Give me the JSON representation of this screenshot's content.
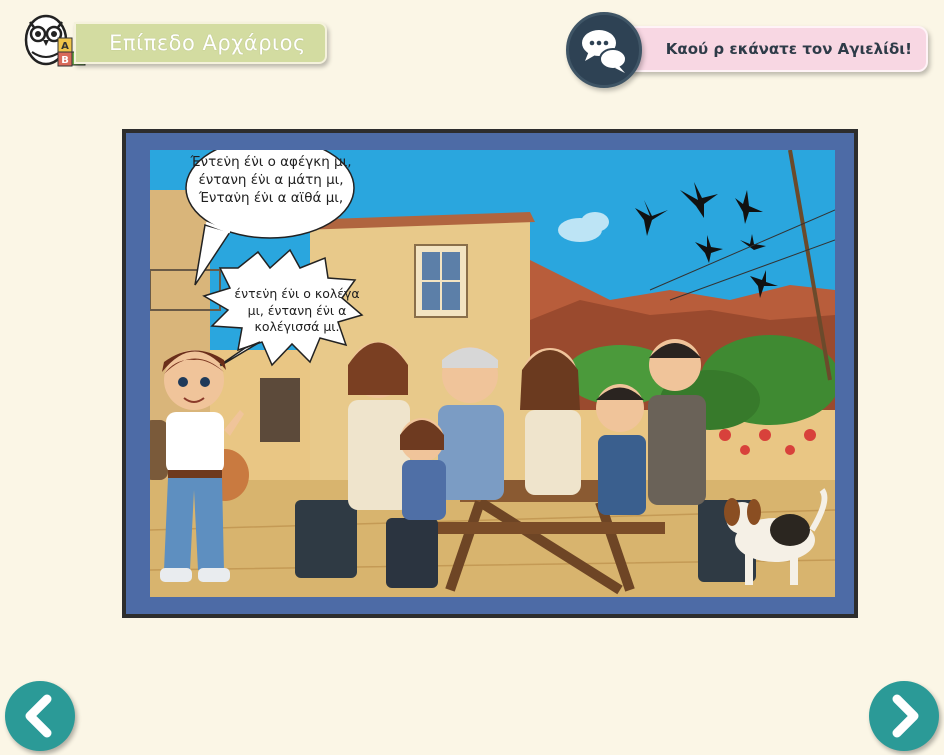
{
  "level": {
    "label": "Επίπεδο Αρχάριος",
    "blocks": [
      "Α",
      "Β",
      "Γ"
    ]
  },
  "phrase_button": {
    "label": "Καού ρ εκάνατε τον Αγιελίδι!",
    "icon": "speech-bubbles-icon"
  },
  "scene": {
    "bubbles": [
      {
        "text": "Έντεν̇η έν̇ι ο αφέγκη μι, έντανη έν̇ι α μάτη μι, Ένταν̇η έν̇ι α αϊθά μι,"
      },
      {
        "text": "έντεν̇η έν̇ι ο κολέγα μι, έντανη έν̇ι α κολέγισσά μι."
      }
    ]
  },
  "nav": {
    "prev_icon": "chevron-left-icon",
    "next_icon": "chevron-right-icon"
  },
  "colors": {
    "background": "#fbf6e6",
    "level_pill": "#d3dca1",
    "phrase_pill": "#f8d7e3",
    "chat_circle": "#2e4254",
    "frame": "#4d6ba6",
    "nav": "#2b9a97"
  }
}
